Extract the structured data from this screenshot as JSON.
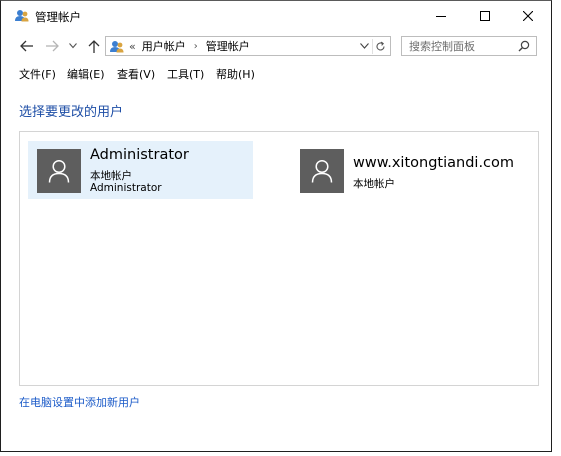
{
  "window": {
    "title": "管理帐户"
  },
  "address": {
    "overflow": "«",
    "segments": [
      "用户帐户",
      "管理帐户"
    ]
  },
  "search": {
    "placeholder": "搜索控制面板"
  },
  "menu": {
    "items": [
      "文件(F)",
      "编辑(E)",
      "查看(V)",
      "工具(T)",
      "帮助(H)"
    ]
  },
  "main": {
    "heading": "选择要更改的用户",
    "users": [
      {
        "name": "Administrator",
        "type": "本地帐户",
        "extra": "Administrator",
        "selected": true
      },
      {
        "name": "www.xitongtiandi.com",
        "type": "本地帐户"
      }
    ],
    "add_user_link": "在电脑设置中添加新用户"
  },
  "colors": {
    "heading": "#1e4ea6",
    "link": "#1a5ac8",
    "selected_tile": "#e5f1fb",
    "avatar": "#5e5e5e"
  },
  "icons": {
    "app": "users-icon",
    "back": "arrow-left-icon",
    "forward": "arrow-right-icon",
    "recent": "chevron-down-icon",
    "up": "arrow-up-icon",
    "dropdown": "chevron-down-icon",
    "refresh": "refresh-icon",
    "search": "search-icon",
    "avatar": "user-icon"
  }
}
